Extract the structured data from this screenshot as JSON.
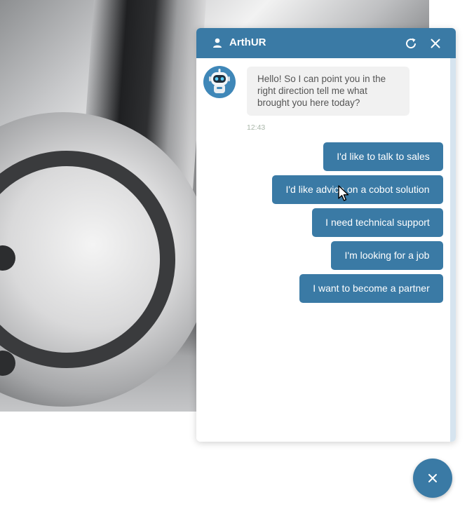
{
  "chat": {
    "title": "ArthUR",
    "bot_message": "Hello! So I can point you in the right direction tell me what brought you here today?",
    "bot_time": "12:43",
    "options": [
      "I'd like to talk to sales",
      "I'd like advice on a cobot solution",
      "I need technical support",
      "I'm looking for a job",
      "I want to become a partner"
    ]
  },
  "icons": {
    "header_user": "user-icon",
    "header_refresh": "refresh-icon",
    "header_close": "close-icon",
    "avatar": "robot-avatar-icon",
    "launcher": "close-icon",
    "pointer": "mouse-cursor-icon"
  },
  "colors": {
    "accent": "#3a7aa5",
    "bubble_bg": "#f1f1f1",
    "time_text": "#a9b6a9"
  }
}
